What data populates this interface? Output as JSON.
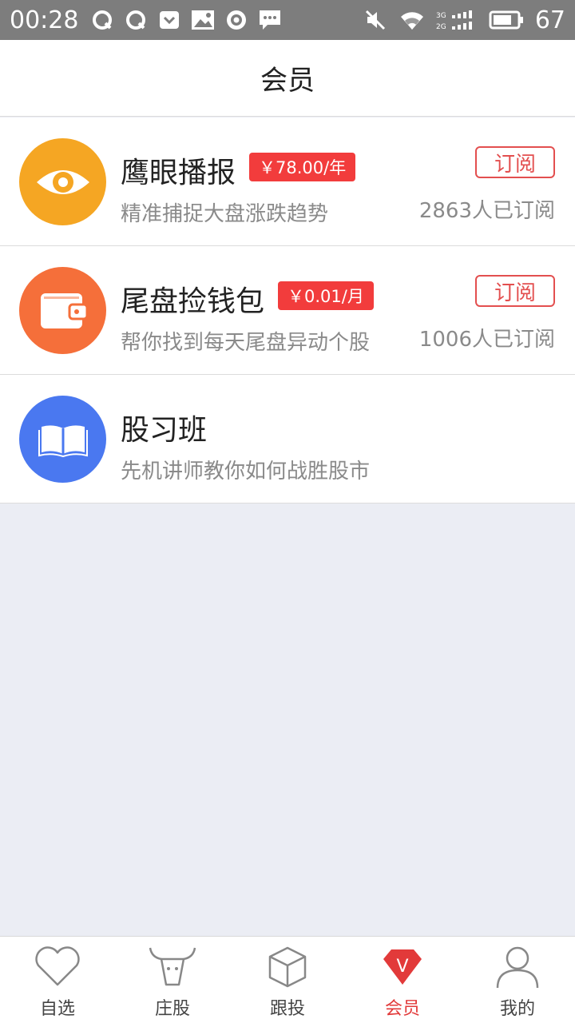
{
  "status_bar": {
    "time": "00:28",
    "battery": "67",
    "left_icons": [
      "q-icon",
      "q-icon",
      "pocket-icon",
      "image-icon",
      "target-icon",
      "message-icon"
    ],
    "right_icons": [
      "mute-icon",
      "wifi-icon",
      "signal-icon",
      "battery-icon"
    ],
    "signal_labels": [
      "3G",
      "2G"
    ]
  },
  "header": {
    "title": "会员"
  },
  "items": [
    {
      "name": "鹰眼播报",
      "price": "￥78.00/年",
      "desc": "精准捕捉大盘涨跌趋势",
      "button": "订阅",
      "count": "2863人已订阅",
      "icon": "eye-icon",
      "color": "#f5a623"
    },
    {
      "name": "尾盘捡钱包",
      "price": "￥0.01/月",
      "desc": "帮你找到每天尾盘异动个股",
      "button": "订阅",
      "count": "1006人已订阅",
      "icon": "wallet-icon",
      "color": "#f56f3a"
    },
    {
      "name": "股习班",
      "desc": "先机讲师教你如何战胜股市",
      "icon": "book-icon",
      "color": "#4a78f0"
    }
  ],
  "tabs": [
    {
      "label": "自选",
      "icon": "heart-icon",
      "active": false
    },
    {
      "label": "庄股",
      "icon": "bull-icon",
      "active": false
    },
    {
      "label": "跟投",
      "icon": "cube-icon",
      "active": false
    },
    {
      "label": "会员",
      "icon": "vip-gem-icon",
      "active": true,
      "badge": "V"
    },
    {
      "label": "我的",
      "icon": "user-icon",
      "active": false
    }
  ],
  "colors": {
    "accent": "#e23a3a",
    "background": "#ebedf4",
    "statusbar": "#7d7d7d"
  }
}
